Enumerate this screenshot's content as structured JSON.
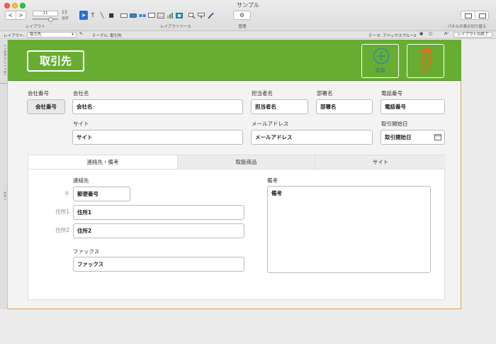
{
  "window": {
    "title": "サンプル"
  },
  "toolbar": {
    "back": "<",
    "forward": ">",
    "zoom": "11",
    "count_num": "13",
    "count_label": "合計",
    "layout_label": "レイアウト",
    "layout_tools_label": "レイアウトツール",
    "manage_label": "管理",
    "panel_toggle_label": "パネルの表示切り替え",
    "tools": [
      "pointer-icon",
      "text-icon",
      "line-icon",
      "rectangle-icon",
      "field-icon",
      "button-icon",
      "button-bar-icon",
      "popover-icon",
      "portal-icon",
      "chart-icon",
      "web-viewer-icon",
      "field-picker-icon",
      "insert-part-icon",
      "format-painter-icon",
      "inspector-icon"
    ]
  },
  "layoutbar": {
    "layout_label": "レイアウト:",
    "layout_value": "取引先",
    "table_label": "テーブル: 取引先",
    "theme_label": "テーマ: アペックスブルー2",
    "exit_button": "レイアウトの終了"
  },
  "rail": {
    "header_label": "ヘッダ(アプリヘッダ)",
    "body_label": "ボディ"
  },
  "header": {
    "title": "取引先",
    "add_label": "追加",
    "delete_label": "削除",
    "colors": {
      "band": "#67ad32",
      "add_icon": "#2f8f9e",
      "delete_icon": "#d8701e",
      "delete_label": "#d8701e"
    }
  },
  "form": {
    "company_no": {
      "label": "会社番号",
      "value": "会社番号"
    },
    "company_name": {
      "label": "会社名",
      "value": "会社名"
    },
    "contact_person": {
      "label": "担当者名",
      "value": "担当者名"
    },
    "department": {
      "label": "部署名",
      "value": "部署名"
    },
    "phone": {
      "label": "電話番号",
      "value": "電話番号"
    },
    "site": {
      "label": "サイト",
      "value": "サイト"
    },
    "email": {
      "label": "メールアドレス",
      "value": "メールアドレス"
    },
    "start_date": {
      "label": "取引開始日",
      "value": "取引開始日"
    }
  },
  "tabs": [
    "連絡先・備考",
    "取扱商品",
    "サイト"
  ],
  "contact": {
    "section_label": "連絡先",
    "postal_mark": "〒",
    "postal_value": "郵便番号",
    "address1_label": "住所1",
    "address1_value": "住所1",
    "address2_label": "住所2",
    "address2_value": "住所2",
    "fax_label": "ファックス",
    "fax_value": "ファックス",
    "memo_label": "備考",
    "memo_value": "備考"
  }
}
